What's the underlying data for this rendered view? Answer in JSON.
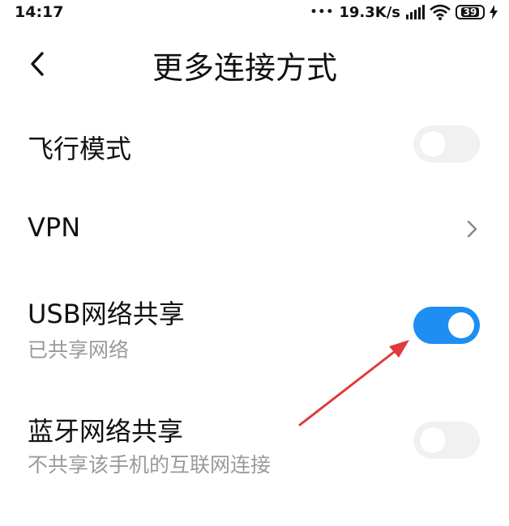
{
  "status_bar": {
    "time": "14:17",
    "net_speed": "19.3K/s",
    "battery": "39",
    "icons": [
      "notification-dots-icon",
      "signal-icon",
      "wifi-icon",
      "battery-icon",
      "charging-icon"
    ]
  },
  "header": {
    "back_icon": "back-chevron-icon",
    "title": "更多连接方式"
  },
  "settings": {
    "airplane": {
      "label": "飞行模式",
      "enabled": false
    },
    "vpn": {
      "label": "VPN",
      "icon": "chevron-right-icon"
    },
    "usb_tether": {
      "label": "USB网络共享",
      "sub": "已共享网络",
      "enabled": true
    },
    "bt_tether": {
      "label": "蓝牙网络共享",
      "sub": "不共享该手机的互联网连接",
      "enabled": false
    }
  },
  "colors": {
    "accent": "#1e8ef2",
    "toggle_off": "#f1f1f1",
    "annotation_arrow": "#e03a3a",
    "subtitle": "#9a9a9a"
  }
}
